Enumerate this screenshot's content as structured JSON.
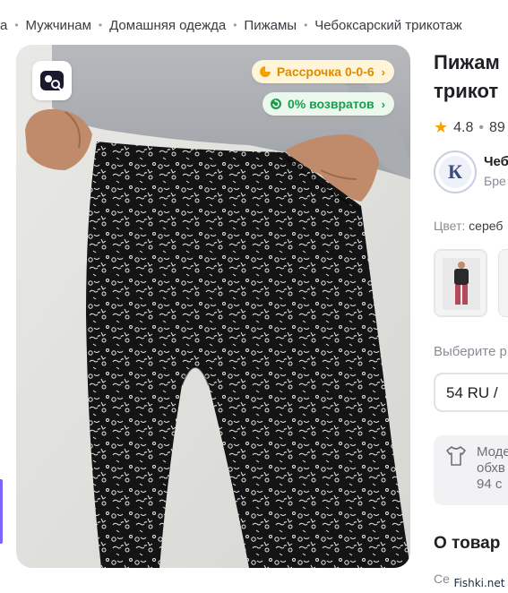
{
  "breadcrumb": {
    "items": [
      "а",
      "Мужчинам",
      "Домашняя одежда",
      "Пижамы",
      "Чебоксарский трикотаж"
    ],
    "separator": "•"
  },
  "gallery": {
    "image_alt": "Мужские пижамные брюки чёрные с белым узором",
    "badge_icon": "image-search-icon",
    "installment_label": "Рассрочка 0-0-6",
    "returns_label": "0% возвратов"
  },
  "product": {
    "title_line1": "Пижам",
    "title_line2": "трикот",
    "rating": "4.8",
    "reviews": "89",
    "seller_name": "Чеб",
    "seller_sub": "Бре",
    "color_label": "Цвет:",
    "color_value": "сереб",
    "size_label": "Выберите р",
    "size_value": "54 RU / ",
    "info_line1": "Моде",
    "info_line2": "обхв",
    "info_line3": "94 с",
    "section_title": "О товар",
    "section_sub": "Се"
  },
  "colors": {
    "installment": "#e08a00",
    "returns": "#1a9e4b",
    "star": "#f5a100",
    "accent": "#7d63ff"
  },
  "watermark": "Fishki.net"
}
